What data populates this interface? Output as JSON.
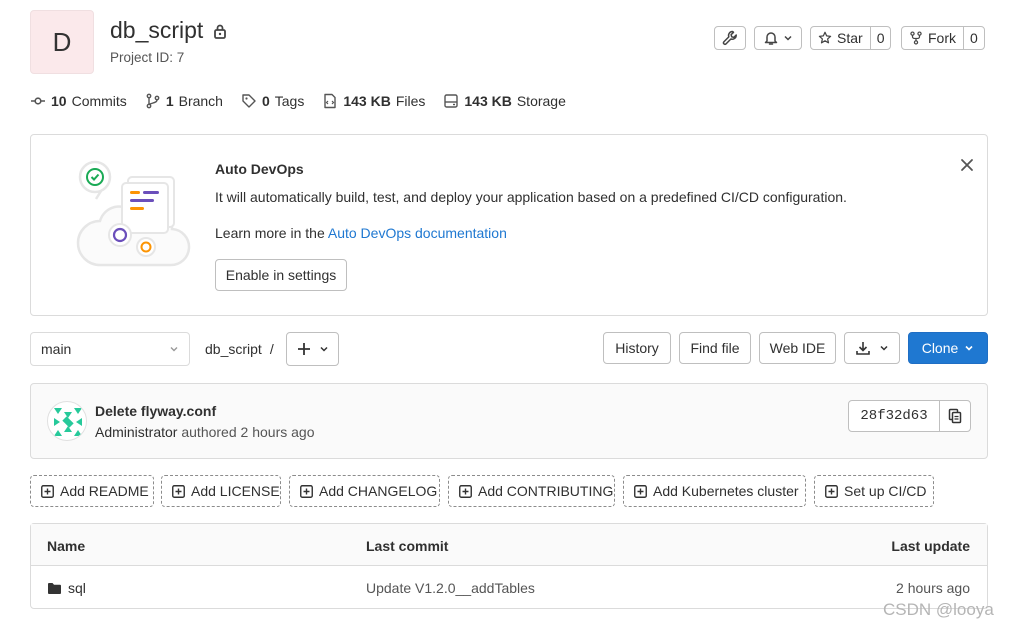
{
  "project": {
    "avatar_letter": "D",
    "name": "db_script",
    "id_text": "Project ID: 7"
  },
  "header_actions": {
    "settings_icon": "wrench-icon",
    "notification_icon": "bell-icon",
    "star_label": "Star",
    "star_count": "0",
    "fork_label": "Fork",
    "fork_count": "0"
  },
  "stats": [
    {
      "icon": "commit-icon",
      "value": "10",
      "label": "Commits"
    },
    {
      "icon": "branch-icon",
      "value": "1",
      "label": "Branch"
    },
    {
      "icon": "tag-icon",
      "value": "0",
      "label": "Tags"
    },
    {
      "icon": "file-icon",
      "value": "143 KB",
      "label": "Files"
    },
    {
      "icon": "storage-icon",
      "value": "143 KB",
      "label": "Storage"
    }
  ],
  "devops": {
    "title": "Auto DevOps",
    "description": "It will automatically build, test, and deploy your application based on a predefined CI/CD configuration.",
    "learn_prefix": "Learn more in the ",
    "learn_link": "Auto DevOps documentation",
    "button": "Enable in settings"
  },
  "toolbar": {
    "branch": "main",
    "breadcrumb": "db_script",
    "separator": "/",
    "history": "History",
    "find_file": "Find file",
    "web_ide": "Web IDE",
    "clone": "Clone"
  },
  "commit": {
    "message": "Delete flyway.conf",
    "author": "Administrator",
    "authored": "authored",
    "time": "2 hours ago",
    "sha": "28f32d63"
  },
  "quick_actions": [
    "Add README",
    "Add LICENSE",
    "Add CHANGELOG",
    "Add CONTRIBUTING",
    "Add Kubernetes cluster",
    "Set up CI/CD"
  ],
  "table": {
    "columns": {
      "name": "Name",
      "last_commit": "Last commit",
      "last_update": "Last update"
    },
    "rows": [
      {
        "name": "sql",
        "last_commit": "Update V1.2.0__addTables",
        "last_update": "2 hours ago"
      }
    ]
  },
  "watermark": "CSDN @looya",
  "colors": {
    "primary": "#1f78d1",
    "link": "#1f78d1",
    "border": "#dbdbdb"
  }
}
